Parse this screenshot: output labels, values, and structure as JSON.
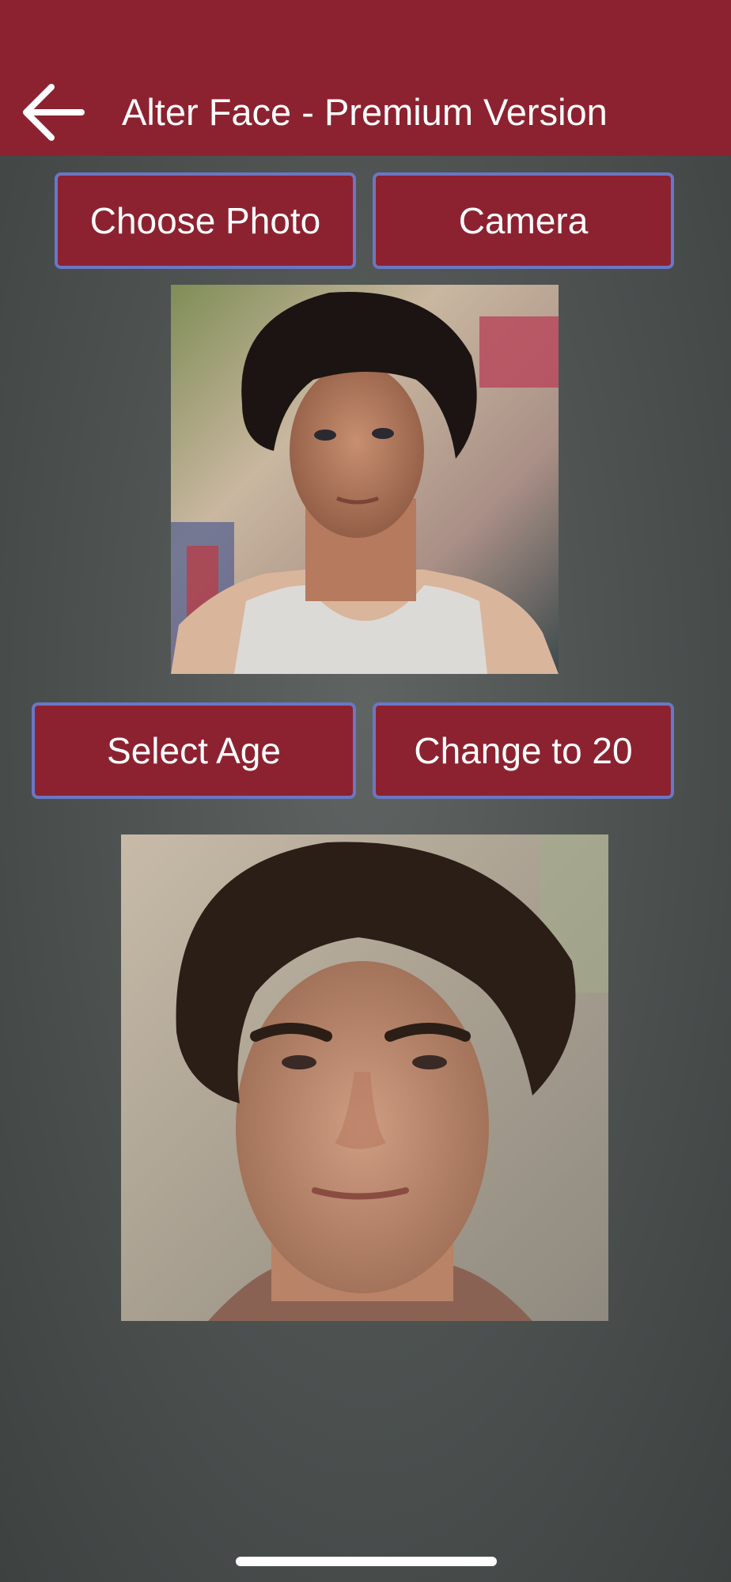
{
  "header": {
    "title": "Alter Face - Premium Version",
    "back_icon": "arrow-left-icon",
    "background_color": "#8c2230"
  },
  "actions": {
    "choose_photo_label": "Choose Photo",
    "camera_label": "Camera",
    "select_age_label": "Select Age",
    "change_label": "Change to 20"
  },
  "colors": {
    "button_fill": "#8c2230",
    "button_border": "#6a77c4",
    "background": "#4f5453"
  }
}
